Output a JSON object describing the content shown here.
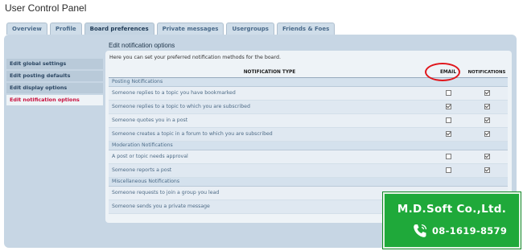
{
  "page": {
    "title": "User Control Panel"
  },
  "tabs": [
    {
      "label": "Overview",
      "active": false
    },
    {
      "label": "Profile",
      "active": false
    },
    {
      "label": "Board preferences",
      "active": true
    },
    {
      "label": "Private messages",
      "active": false
    },
    {
      "label": "Usergroups",
      "active": false
    },
    {
      "label": "Friends & Foes",
      "active": false
    }
  ],
  "sidebar": {
    "items": [
      {
        "label": "Edit global settings",
        "active": false
      },
      {
        "label": "Edit posting defaults",
        "active": false
      },
      {
        "label": "Edit display options",
        "active": false
      },
      {
        "label": "Edit notification options",
        "active": true
      }
    ]
  },
  "main": {
    "section_title": "Edit notification options",
    "description": "Here you can set your preferred notification methods for the board.",
    "columns": {
      "type": "NOTIFICATION TYPE",
      "email": "EMAIL",
      "notifications": "NOTIFICATIONS"
    },
    "categories": [
      {
        "name": "Posting Notifications",
        "rows": [
          {
            "label": "Someone replies to a topic you have bookmarked",
            "email": false,
            "notifications": true
          },
          {
            "label": "Someone replies to a topic to which you are subscribed",
            "email": true,
            "notifications": true
          },
          {
            "label": "Someone quotes you in a post",
            "email": false,
            "notifications": true
          },
          {
            "label": "Someone creates a topic in a forum to which you are subscribed",
            "email": true,
            "notifications": true
          }
        ]
      },
      {
        "name": "Moderation Notifications",
        "rows": [
          {
            "label": "A post or topic needs approval",
            "email": false,
            "notifications": true
          },
          {
            "label": "Someone reports a post",
            "email": false,
            "notifications": true
          }
        ]
      },
      {
        "name": "Miscellaneous Notifications",
        "rows": [
          {
            "label": "Someone requests to join a group you lead",
            "email": null,
            "notifications": null
          },
          {
            "label": "Someone sends you a private message",
            "email": null,
            "notifications": null
          }
        ]
      }
    ]
  },
  "annotation": {
    "highlight_color": "#e0151b",
    "target": "EMAIL"
  },
  "watermark": {
    "company": "M.D.Soft Co.,Ltd.",
    "phone": "08-1619-8579",
    "icon": "phone-icon",
    "background": "#1fa93a"
  }
}
